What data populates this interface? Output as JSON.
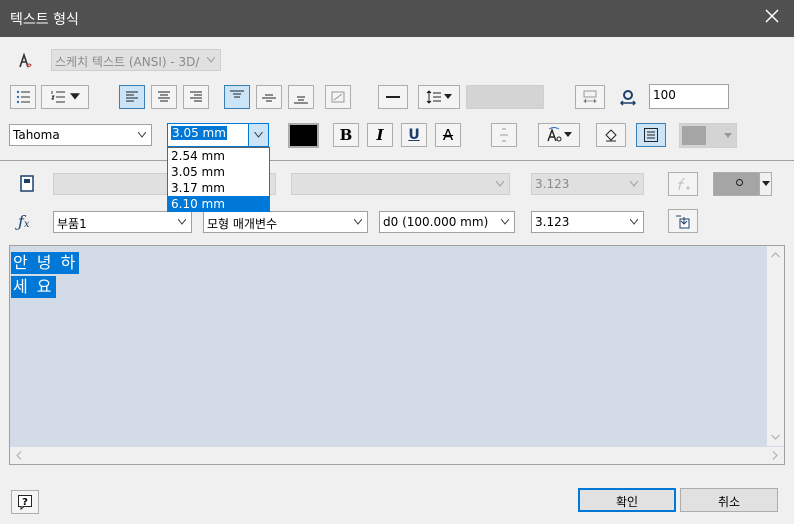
{
  "window": {
    "title": "텍스트 형식"
  },
  "toolbar1": {
    "style_combo": "스케치 텍스트 (ANSI) - 3D/",
    "width_value": "100"
  },
  "toolbar2": {
    "font": "Tahoma",
    "size": "3.05 mm",
    "bold": "B",
    "italic": "I",
    "underline": "U",
    "strike": "A"
  },
  "size_dropdown": {
    "options": [
      "2.54 mm",
      "3.05 mm",
      "3.17 mm",
      "6.10 mm"
    ],
    "selected_index": 3
  },
  "row3": {
    "precision": "3.123"
  },
  "row4": {
    "component": "부품1",
    "param_type": "모형 매개변수",
    "parameter": "d0 (100.000 mm)",
    "precision": "3.123"
  },
  "editor": {
    "lines": [
      "안 녕 하",
      "세 요"
    ]
  },
  "footer": {
    "ok": "확인",
    "cancel": "취소"
  },
  "colors": {
    "titlebar": "#505050",
    "selection": "#0078d7",
    "editor_bg": "#d3dbe6"
  }
}
